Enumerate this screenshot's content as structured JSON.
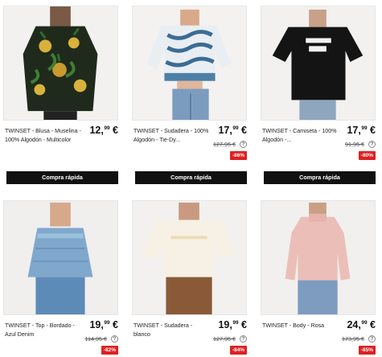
{
  "products": [
    {
      "name": "TWINSET - Blusa - Muselina - 100% Algodón - Multicolor",
      "price_main": "12,",
      "price_cents": "99",
      "currency": "€",
      "buy_label": "Compra rápida",
      "image_icon": "floral-blouse-photo"
    },
    {
      "name": "TWINSET - Sudadera - 100% Algodón - Tie-Dy...",
      "price_main": "17,",
      "price_cents": "99",
      "currency": "€",
      "old_price": "127,95 €",
      "discount": "-86%",
      "buy_label": "Compra rápida",
      "image_icon": "tie-dye-sweatshirt-photo"
    },
    {
      "name": "TWINSET - Camiseta - 100% Algodón -...",
      "price_main": "17,",
      "price_cents": "99",
      "currency": "€",
      "old_price": "91,95 €",
      "discount": "-80%",
      "buy_label": "Compra rápida",
      "image_icon": "black-tshirt-photo"
    },
    {
      "name": "TWINSET - Top - Bordado - Azul Denim",
      "price_main": "19,",
      "price_cents": "99",
      "currency": "€",
      "old_price": "114,95 €",
      "discount": "-82%",
      "image_icon": "denim-top-photo"
    },
    {
      "name": "TWINSET - Sudadera - blanco",
      "price_main": "19,",
      "price_cents": "99",
      "currency": "€",
      "old_price": "127,95 €",
      "discount": "-84%",
      "image_icon": "white-sweatshirt-photo"
    },
    {
      "name": "TWINSET - Body - Rosa",
      "price_main": "24,",
      "price_cents": "99",
      "currency": "€",
      "old_price": "173,95 €",
      "discount": "-85%",
      "image_icon": "pink-body-photo"
    }
  ],
  "colors": {
    "buy_bg": "#111111",
    "discount_bg": "#e02020"
  }
}
